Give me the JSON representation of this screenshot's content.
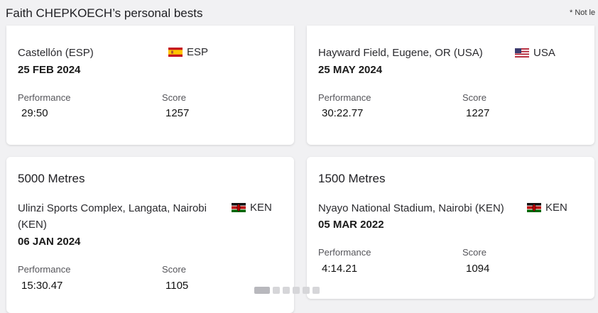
{
  "header": {
    "title": "Faith CHEPKOECH’s personal bests",
    "note": "* Not le"
  },
  "labels": {
    "performance": "Performance",
    "score": "Score"
  },
  "cards": [
    {
      "event": "",
      "venue": "Castellón (ESP)",
      "country": "ESP",
      "date": "25 FEB 2024",
      "performance": "29:50",
      "score": "1257"
    },
    {
      "event": "",
      "venue": "Hayward Field, Eugene, OR (USA)",
      "country": "USA",
      "date": "25 MAY 2024",
      "performance": "30:22.77",
      "score": "1227"
    },
    {
      "event": "5000 Metres",
      "venue": "Ulinzi Sports Complex, Langata, Nairobi (KEN)",
      "country": "KEN",
      "date": "06 JAN 2024",
      "performance": "15:30.47",
      "score": "1105"
    },
    {
      "event": "1500 Metres",
      "venue": "Nyayo National Stadium, Nairobi (KEN)",
      "country": "KEN",
      "date": "05 MAR 2022",
      "performance": "4:14.21",
      "score": "1094"
    }
  ],
  "carousel": {
    "count": 6,
    "active": 0
  },
  "colors": {
    "background": "#f1f1f3",
    "card": "#ffffff",
    "text": "#1d1d1f"
  }
}
